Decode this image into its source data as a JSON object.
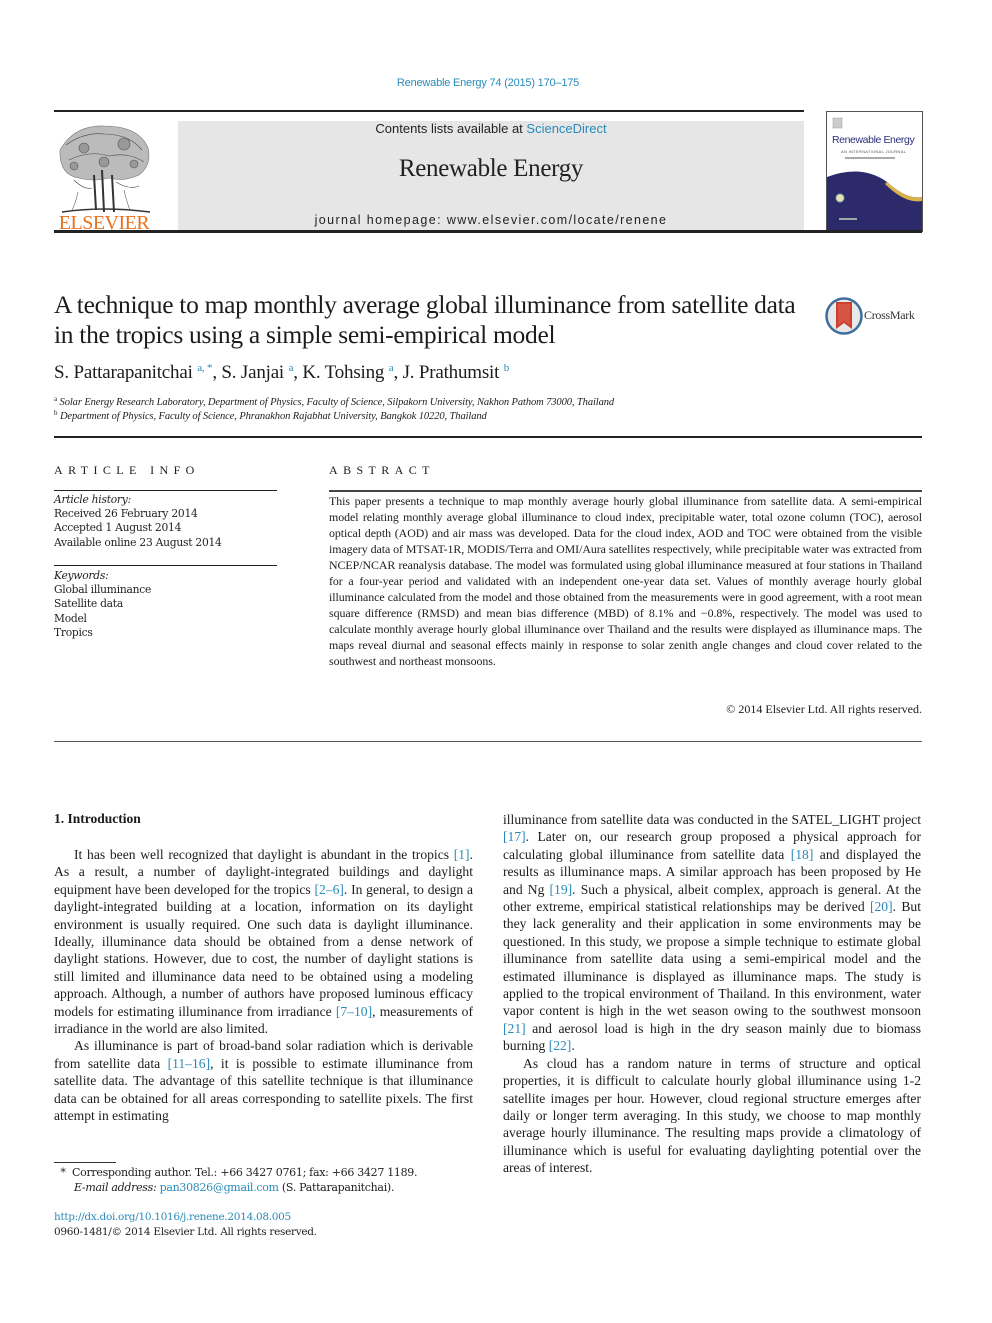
{
  "header": {
    "journal_ref": "Renewable Energy 74 (2015) 170–175",
    "contents_prefix": "Contents lists available at ",
    "contents_link": "ScienceDirect",
    "journal_name": "Renewable Energy",
    "homepage_prefix": "journal homepage: ",
    "homepage_url": "www.elsevier.com/locate/renene",
    "publisher_logo_text": "ELSEVIER",
    "cover_title": "Renewable Energy",
    "cover_subtitle": "AN INTERNATIONAL JOURNAL",
    "crossmark_label": "CrossMark"
  },
  "article": {
    "title": "A technique to map monthly average global illuminance from satellite data in the tropics using a simple semi-empirical model",
    "authors": [
      {
        "name": "S. Pattarapanitchai",
        "marks": "a, *"
      },
      {
        "name": "S. Janjai",
        "marks": "a"
      },
      {
        "name": "K. Tohsing",
        "marks": "a"
      },
      {
        "name": "J. Prathumsit",
        "marks": "b"
      }
    ],
    "affiliations": [
      {
        "mark": "a",
        "text": "Solar Energy Research Laboratory, Department of Physics, Faculty of Science, Silpakorn University, Nakhon Pathom 73000, Thailand"
      },
      {
        "mark": "b",
        "text": "Department of Physics, Faculty of Science, Phranakhon Rajabhat University, Bangkok 10220, Thailand"
      }
    ]
  },
  "article_info": {
    "heading": "ARTICLE INFO",
    "history_label": "Article history:",
    "history": [
      "Received 26 February 2014",
      "Accepted 1 August 2014",
      "Available online 23 August 2014"
    ],
    "keywords_label": "Keywords:",
    "keywords": [
      "Global illuminance",
      "Satellite data",
      "Model",
      "Tropics"
    ]
  },
  "abstract": {
    "heading": "ABSTRACT",
    "text": "This paper presents a technique to map monthly average hourly global illuminance from satellite data. A semi-empirical model relating monthly average global illuminance to cloud index, precipitable water, total ozone column (TOC), aerosol optical depth (AOD) and air mass was developed. Data for the cloud index, AOD and TOC were obtained from the visible imagery data of MTSAT-1R, MODIS/Terra and OMI/Aura satellites respectively, while precipitable water was extracted from NCEP/NCAR reanalysis database. The model was formulated using global illuminance measured at four stations in Thailand for a four-year period and validated with an independent one-year data set. Values of monthly average hourly global illuminance calculated from the model and those obtained from the measurements were in good agreement, with a root mean square difference (RMSD) and mean bias difference (MBD) of 8.1% and −0.8%, respectively. The model was used to calculate monthly average hourly global illuminance over Thailand and the results were displayed as illuminance maps. The maps reveal diurnal and seasonal effects mainly in response to solar zenith angle changes and cloud cover related to the southwest and northeast monsoons.",
    "copyright": "© 2014 Elsevier Ltd. All rights reserved."
  },
  "body": {
    "section_heading": "1.  Introduction",
    "left_paragraphs": [
      [
        {
          "t": "It has been well recognized that daylight is abundant in the tropics "
        },
        {
          "ref": "[1]"
        },
        {
          "t": ". As a result, a number of daylight-integrated buildings and daylight equipment have been developed for the tropics "
        },
        {
          "ref": "[2–6]"
        },
        {
          "t": ". In general, to design a daylight-integrated building at a location, information on its daylight environment is usually required. One such data is daylight illuminance. Ideally, illuminance data should be obtained from a dense network of daylight stations. However, due to cost, the number of daylight stations is still limited and illuminance data need to be obtained using a modeling approach. Although, a number of authors have proposed luminous efficacy models for estimating illuminance from irradiance "
        },
        {
          "ref": "[7–10]"
        },
        {
          "t": ", measurements of irradiance in the world are also limited."
        }
      ],
      [
        {
          "t": "As illuminance is part of broad-band solar radiation which is derivable from satellite data "
        },
        {
          "ref": "[11–16]"
        },
        {
          "t": ", it is possible to estimate illuminance from satellite data. The advantage of this satellite technique is that illuminance data can be obtained for all areas corresponding to satellite pixels. The first attempt in estimating"
        }
      ]
    ],
    "right_paragraphs": [
      [
        {
          "t": "illuminance from satellite data was conducted in the SATEL_LIGHT project "
        },
        {
          "ref": "[17]"
        },
        {
          "t": ". Later on, our research group proposed a physical approach for calculating global illuminance from satellite data "
        },
        {
          "ref": "[18]"
        },
        {
          "t": " and displayed the results as illuminance maps. A similar approach has been proposed by He and Ng "
        },
        {
          "ref": "[19]"
        },
        {
          "t": ". Such a physical, albeit complex, approach is general. At the other extreme, empirical statistical relationships may be derived "
        },
        {
          "ref": "[20]"
        },
        {
          "t": ". But they lack generality and their application in some environments may be questioned. In this study, we propose a simple technique to estimate global illuminance from satellite data using a semi-empirical model and the estimated illuminance is displayed as illuminance maps. The study is applied to the tropical environment of Thailand. In this environment, water vapor content is high in the wet season owing to the southwest monsoon "
        },
        {
          "ref": "[21]"
        },
        {
          "t": " and aerosol load is high in the dry season mainly due to biomass burning "
        },
        {
          "ref": "[22]"
        },
        {
          "t": "."
        }
      ],
      [
        {
          "t": "As cloud has a random nature in terms of structure and optical properties, it is difficult to calculate hourly global illuminance using 1-2 satellite images per hour. However, cloud regional structure emerges after daily or longer term averaging. In this study, we choose to map monthly average hourly illuminance. The resulting maps provide a climatology of illuminance which is useful for evaluating daylighting potential over the areas of interest."
        }
      ]
    ]
  },
  "footnote": {
    "mark": "*",
    "corresponding": "Corresponding author. Tel.: +66 3427 0761; fax: +66 3427 1189.",
    "email_label": "E-mail address:",
    "email": "pan30826@gmail.com",
    "email_suffix": " (S. Pattarapanitchai)."
  },
  "doi": "http://dx.doi.org/10.1016/j.renene.2014.08.005",
  "issn_line": "0960-1481/© 2014 Elsevier Ltd. All rights reserved.",
  "colors": {
    "link": "#2a8ab8",
    "elsevier_orange": "#e9711c",
    "banner_gray": "#e6e6e6",
    "cover_navy": "#2c2a6b",
    "cover_gold": "#d9b24a",
    "crossmark_red": "#c9402f",
    "crossmark_blue": "#3d6e9e"
  }
}
